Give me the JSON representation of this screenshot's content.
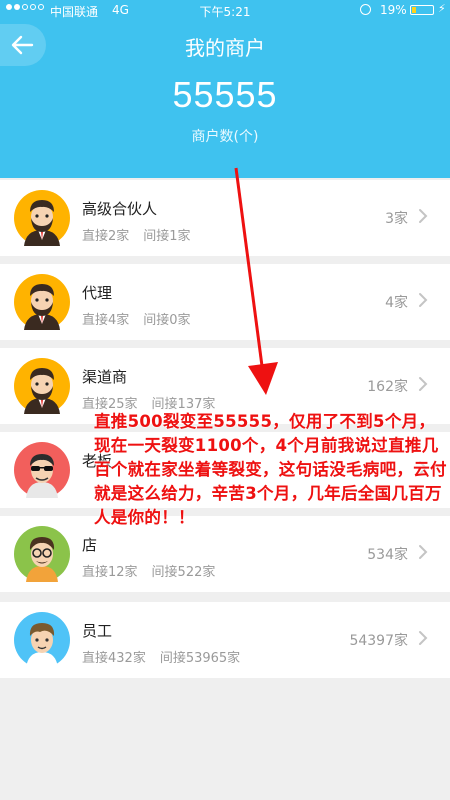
{
  "status_bar": {
    "carrier": "中国联通",
    "network": "4G",
    "time": "下午5:21",
    "battery_percent": "19%",
    "battery_level": 0.19,
    "battery_color": "#ffd21a"
  },
  "header": {
    "title": "我的商户",
    "total": "55555",
    "total_label": "商户数(个)",
    "background": "#3fc2ef"
  },
  "merchants": [
    {
      "name": "高级合伙人",
      "direct": "直接2家",
      "indirect": "间接1家",
      "count": "3家",
      "avatar": "businessman-avatar-icon"
    },
    {
      "name": "代理",
      "direct": "直接4家",
      "indirect": "间接0家",
      "count": "4家",
      "avatar": "businessman-avatar-icon"
    },
    {
      "name": "渠道商",
      "direct": "直接25家",
      "indirect": "间接137家",
      "count": "162家",
      "avatar": "businessman-avatar-icon"
    },
    {
      "name": "老板",
      "direct": "",
      "indirect": "",
      "count": "",
      "avatar": "sunglasses-avatar-icon"
    },
    {
      "name": "店",
      "direct": "直接12家",
      "indirect": "间接522家",
      "count": "534家",
      "avatar": "glasses-avatar-icon"
    },
    {
      "name": "员工",
      "direct": "直接432家",
      "indirect": "间接53965家",
      "count": "54397家",
      "avatar": "employee-avatar-icon"
    }
  ],
  "annotation": {
    "text": "直推500裂变至55555，仅用了不到5个月，现在一天裂变1100个，4个月前我说过直推几百个就在家坐着等裂变，这句话没毛病吧，云付就是这么给力，辛苦3个月，几年后全国几百万人是你的！！",
    "color": "#ee1111"
  }
}
